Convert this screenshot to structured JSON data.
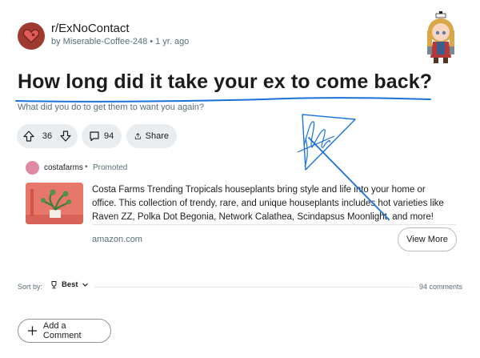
{
  "header": {
    "subreddit": "r/ExNoContact",
    "author": "by Miserable-Coffee-248",
    "age": "1 yr. ago"
  },
  "post": {
    "title": "How long did it take your ex to come back?",
    "body": "What did you do to get them to want you again?"
  },
  "actions": {
    "votes": "36",
    "comments": "94",
    "share_label": "Share"
  },
  "ad": {
    "advertiser": "costafarms",
    "promoted_label": "Promoted",
    "text": "Costa Farms Trending Tropicals houseplants bring style and life into your home or office. This collection of trendy, rare, and unique houseplants includes hot varieties like Raven ZZ, Polka Dot Begonia, Network Calathea, Scindapsus Moonlight, and more!",
    "domain": "amazon.com",
    "cta": "View More"
  },
  "comments_bar": {
    "sort_label": "Sort by:",
    "sort_value": "Best",
    "count": "94 comments"
  },
  "add_comment_label": "Add a Comment",
  "colors": {
    "accent_annotation": "#1a73d9",
    "pill_bg": "#eaedef",
    "muted_text": "#576f76"
  },
  "icons": [
    "heart-icon",
    "upvote-icon",
    "downvote-icon",
    "comment-icon",
    "share-icon",
    "trophy-icon",
    "chevron-down-icon",
    "plus-icon"
  ]
}
